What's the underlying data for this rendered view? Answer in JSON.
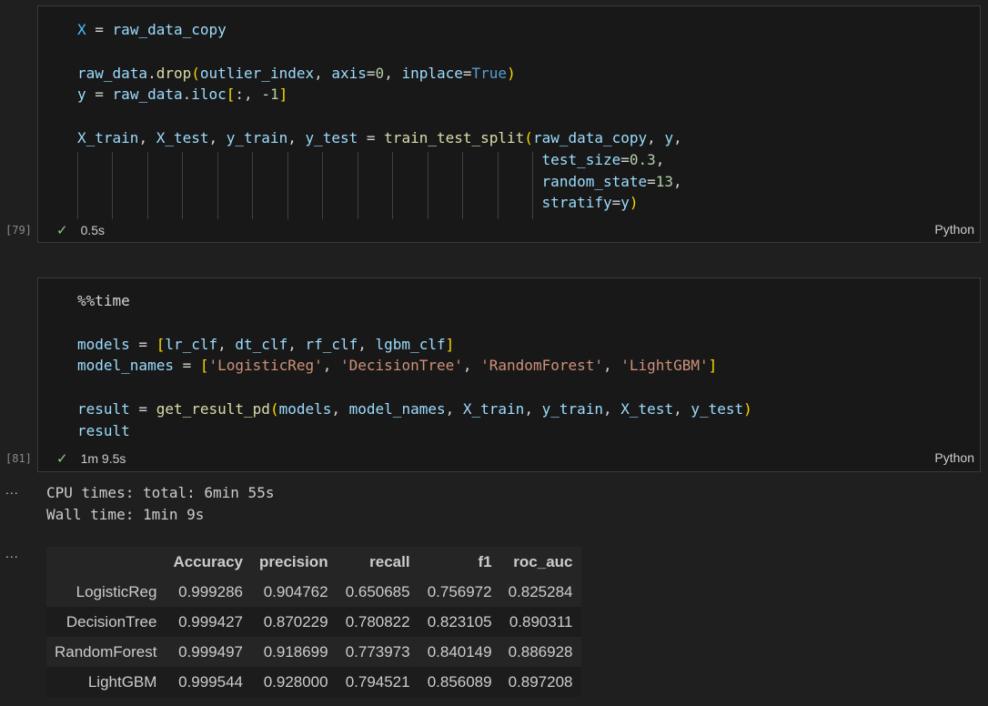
{
  "cells": [
    {
      "execution_count": "[79]",
      "status_time": "0.5s",
      "language": "Python",
      "code_lines": [
        "X = raw_data_copy",
        "",
        "raw_data.drop(outlier_index, axis=0, inplace=True)",
        "y = raw_data.iloc[:, -1]",
        "",
        "X_train, X_test, y_train, y_test = train_test_split(raw_data_copy, y,",
        "                                                     test_size=0.3,",
        "                                                     random_state=13,",
        "                                                     stratify=y)"
      ]
    },
    {
      "execution_count": "[81]",
      "status_time": "1m 9.5s",
      "language": "Python",
      "code_lines": [
        "%%time",
        "",
        "models = [lr_clf, dt_clf, rf_clf, lgbm_clf]",
        "model_names = ['LogisticReg', 'DecisionTree', 'RandomForest', 'LightGBM']",
        "",
        "result = get_result_pd(models, model_names, X_train, y_train, X_test, y_test)",
        "result"
      ]
    }
  ],
  "output": {
    "ellipsis": "...",
    "stdout_lines": [
      "CPU times: total: 6min 55s",
      "Wall time: 1min 9s"
    ],
    "table": {
      "columns": [
        "Accuracy",
        "precision",
        "recall",
        "f1",
        "roc_auc"
      ],
      "rows": [
        {
          "index": "LogisticReg",
          "values": [
            "0.999286",
            "0.904762",
            "0.650685",
            "0.756972",
            "0.825284"
          ]
        },
        {
          "index": "DecisionTree",
          "values": [
            "0.999427",
            "0.870229",
            "0.780822",
            "0.823105",
            "0.890311"
          ]
        },
        {
          "index": "RandomForest",
          "values": [
            "0.999497",
            "0.918699",
            "0.773973",
            "0.840149",
            "0.886928"
          ]
        },
        {
          "index": "LightGBM",
          "values": [
            "0.999544",
            "0.928000",
            "0.794521",
            "0.856089",
            "0.897208"
          ]
        }
      ]
    }
  },
  "icons": {
    "check": "check-icon",
    "output_menu": "ellipsis-icon"
  },
  "colors": {
    "background": "#1f1f1f",
    "cell_background": "#181818",
    "success": "#89d185"
  }
}
